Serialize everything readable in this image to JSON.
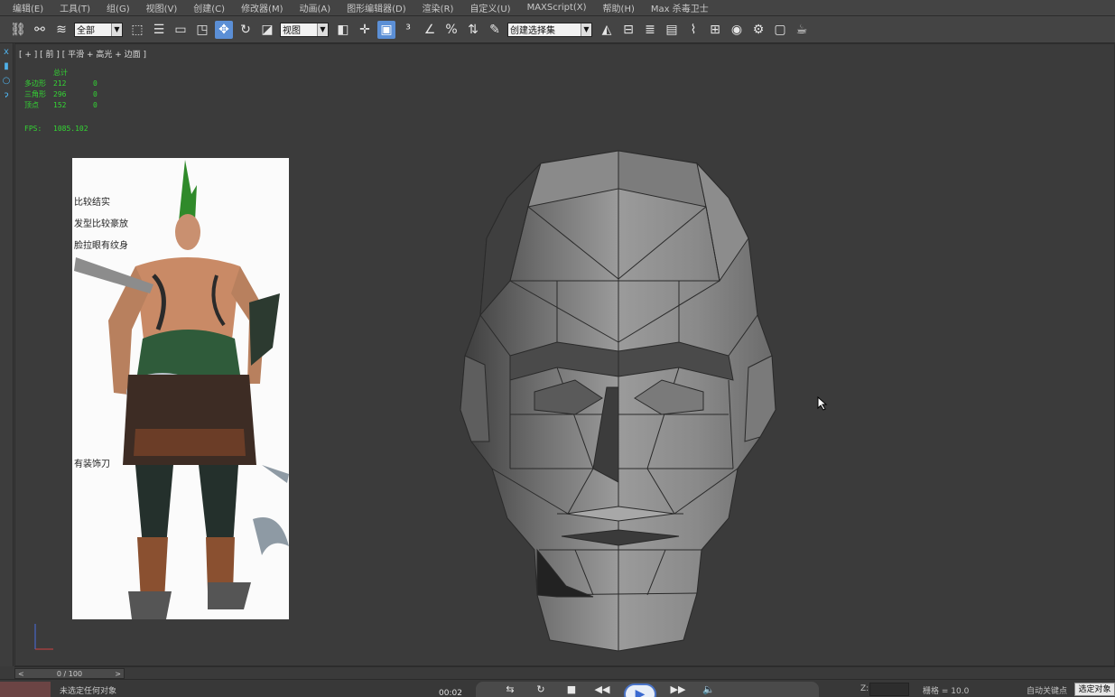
{
  "menu": [
    "编辑(E)",
    "工具(T)",
    "组(G)",
    "视图(V)",
    "创建(C)",
    "修改器(M)",
    "动画(A)",
    "图形编辑器(D)",
    "渲染(R)",
    "自定义(U)",
    "MAXScript(X)",
    "帮助(H)",
    "Max 杀毒卫士"
  ],
  "toolbar": {
    "selection_filter": "全部",
    "ref_coord": "视图",
    "named_selection": "创建选择集"
  },
  "viewport": {
    "label": "[ + ] [ 前 ] [ 平滑 + 高光 + 边面 ]",
    "stats": {
      "header": "总计",
      "rows": [
        {
          "label": "多边形",
          "total": "212",
          "sel": "0"
        },
        {
          "label": "三角形",
          "total": "296",
          "sel": "0"
        },
        {
          "label": "顶点",
          "total": "152",
          "sel": "0"
        }
      ],
      "fps_label": "FPS:",
      "fps_value": "1085.102"
    },
    "reference_notes": [
      "比较结实",
      "发型比较豪放",
      "脸拉眼有纹身",
      "有装饰刀"
    ]
  },
  "timeline": {
    "frame": "0 / 100"
  },
  "status": {
    "message": "未选定任何对象",
    "time": "00:02",
    "z_label": "Z:",
    "grid": "栅格 = 10.0",
    "autokey": "自动关键点",
    "selected_btn": "选定对象"
  },
  "colors": {
    "accent": "#5b8fd6",
    "stats_green": "#33d633",
    "viewport_bg": "#3b3b3b"
  }
}
